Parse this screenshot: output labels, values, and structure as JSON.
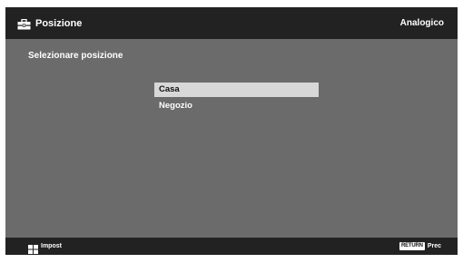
{
  "header": {
    "title": "Posizione",
    "title_icon": "toolbox-icon",
    "right_label": "Analogico"
  },
  "main": {
    "section_title": "Selezionare posizione",
    "options": [
      {
        "label": "Casa",
        "selected": true
      },
      {
        "label": "Negozio",
        "selected": false
      }
    ]
  },
  "footer": {
    "left_icon": "options-grid-icon",
    "left_label": "Impost",
    "return_key_label": "RETURN",
    "right_label": "Prec"
  },
  "colors": {
    "bar_background": "#222222",
    "content_background": "#6b6b6b",
    "selected_highlight": "#d8d8d8"
  }
}
